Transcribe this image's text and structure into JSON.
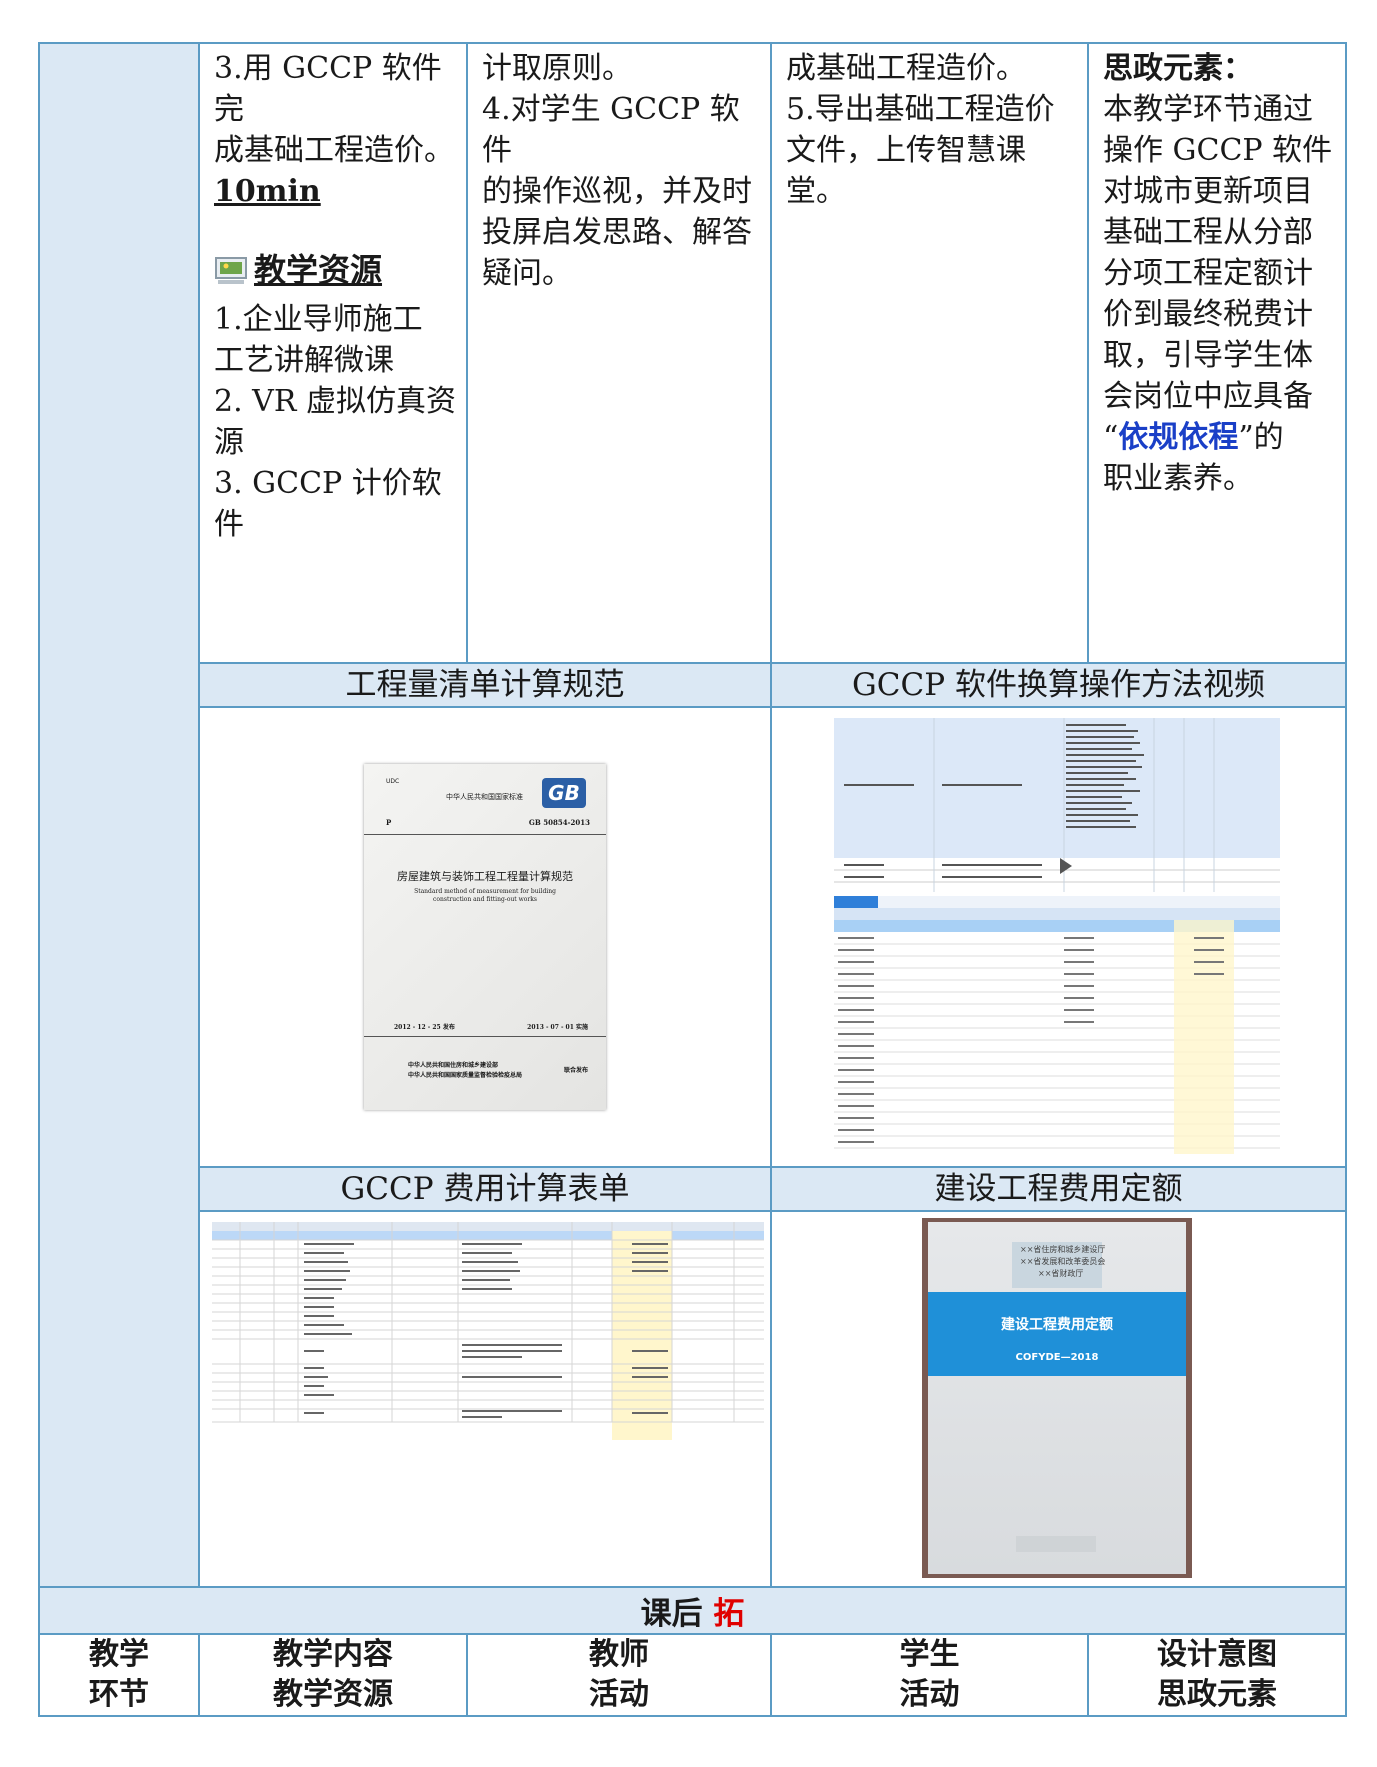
{
  "row1": {
    "content_lines": [
      "3.用 GCCP 软件完",
      "成基础工程造价。"
    ],
    "duration": "10min",
    "resource_title": "教学资源",
    "resources": [
      "1.企业导师施工",
      "工艺讲解微课",
      "2. VR 虚拟仿真资",
      "源",
      "3. GCCP 计价软件"
    ],
    "teacher": [
      "计取原则。",
      "4.对学生 GCCP 软件",
      "的操作巡视，并及时",
      "投屏启发思路、解答",
      "疑问。"
    ],
    "student": [
      "成基础工程造价。",
      "5.导出基础工程造价",
      "文件，上传智慧课堂。"
    ],
    "design_title": "思政元素：",
    "design": [
      "本教学环节通过",
      "操作 GCCP 软件",
      "对城市更新项目",
      "基础工程从分部",
      "分项工程定额计",
      "价到最终税费计",
      "取，引导学生体",
      "会岗位中应具备"
    ],
    "design_quote_open": "“",
    "design_quote_text": "依规依程",
    "design_quote_close": "”的",
    "design_last": "职业素养。"
  },
  "captions": {
    "c1": "工程量清单计算规范",
    "c2": "GCCP 软件换算操作方法视频",
    "c3": "GCCP 费用计算表单",
    "c4": "建设工程费用定额"
  },
  "images": {
    "standard": {
      "udc": "UDC",
      "org": "中华人民共和国国家标准",
      "p": "P",
      "code": "GB 50854-2013",
      "logo": "GB",
      "title": "房屋建筑与装饰工程工程量计算规范",
      "en1": "Standard method of measurement for building",
      "en2": "construction and fitting-out works",
      "publish": "2012 - 12 - 25  发布",
      "implement": "2013 - 07 - 01  实施",
      "issuer1": "中华人民共和国住房和城乡建设部",
      "issuer2": "中华人民共和国国家质量监督检验检疫总局",
      "joint": "联合发布"
    },
    "quota": {
      "top1": "××省住房和城乡建设厅",
      "top2": "××省发展和改革委员会",
      "top3": "××省财政厅",
      "title": "建设工程费用定额",
      "code": "COFYDE—2018"
    }
  },
  "section": {
    "label": "课后",
    "highlight": "拓"
  },
  "header": {
    "col1a": "教学",
    "col1b": "环节",
    "col2a": "教学内容",
    "col2b": "教学资源",
    "col3a": "教师",
    "col3b": "活动",
    "col4a": "学生",
    "col4b": "活动",
    "col5a": "设计意图",
    "col5b": "思政元素"
  },
  "colors": {
    "border": "#5b9bc4",
    "caption_bg": "#dbe8f4",
    "highlight_red": "#e00000",
    "quote_blue": "#1a3fc7"
  }
}
